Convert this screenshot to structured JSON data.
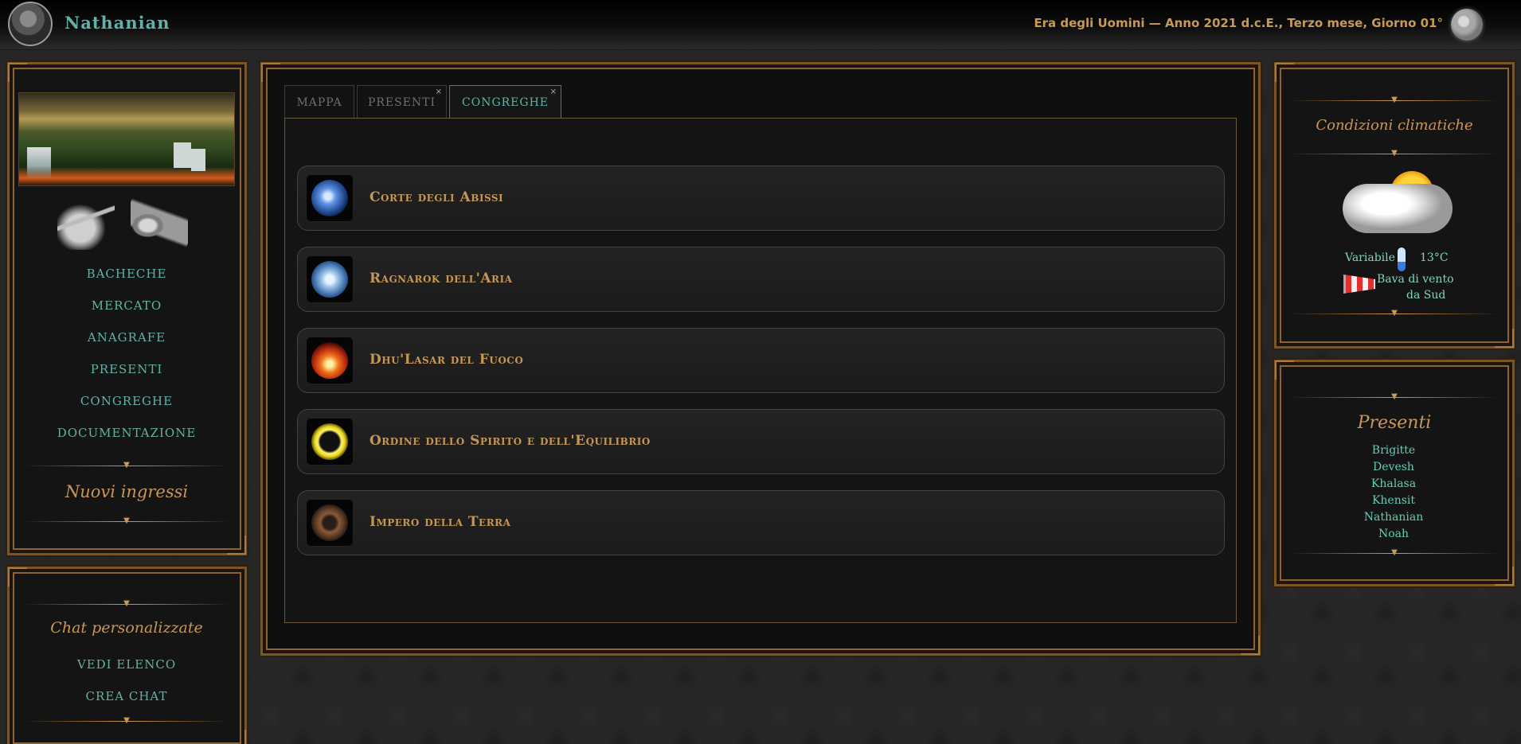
{
  "topbar": {
    "username": "Nathanian",
    "date_text": "Era degli Uomini — Anno 2021 d.c.E., Terzo mese, Giorno 01°"
  },
  "left_menu": {
    "links": [
      "BACHECHE",
      "MERCATO",
      "ANAGRAFE",
      "PRESENTI",
      "CONGREGHE",
      "DOCUMENTAZIONE"
    ],
    "nuovi_ingressi_title": "Nuovi ingressi"
  },
  "chat_panel": {
    "title": "Chat personalizzate",
    "links": [
      "VEDI ELENCO",
      "CREA CHAT"
    ]
  },
  "tabs": [
    {
      "label": "MAPPA",
      "closable": false,
      "active": false
    },
    {
      "label": "PRESENTI",
      "closable": true,
      "active": false,
      "close_glyph": "×"
    },
    {
      "label": "CONGREGHE",
      "closable": true,
      "active": true,
      "close_glyph": "×"
    }
  ],
  "guilds": [
    {
      "name": "Corte degli Abissi",
      "icon": "water-emblem-icon",
      "color": "#3d78d6"
    },
    {
      "name": "Ragnarok dell'Aria",
      "icon": "air-spiral-icon",
      "color": "#9bc3e8"
    },
    {
      "name": "Dhu'Lasar del Fuoco",
      "icon": "fire-emblem-icon",
      "color": "#e24a14"
    },
    {
      "name": "Ordine dello Spirito e dell'Equilibrio",
      "icon": "spirit-ring-icon",
      "color": "#e8d21e"
    },
    {
      "name": "Impero della Terra",
      "icon": "earth-emblem-icon",
      "color": "#8a5a3a"
    }
  ],
  "weather": {
    "title": "Condizioni climatiche",
    "condition": "Variabile",
    "temperature": "13°C",
    "wind_line1": "Bava di vento",
    "wind_line2": "da Sud"
  },
  "presenti": {
    "title": "Presenti",
    "names": [
      "Brigitte",
      "Devesh",
      "Khalasa",
      "Khensit",
      "Nathanian",
      "Noah"
    ]
  },
  "colors": {
    "accent_teal": "#5fb3a6",
    "gold": "#c49756",
    "frame_bronze": "#8d6431"
  }
}
